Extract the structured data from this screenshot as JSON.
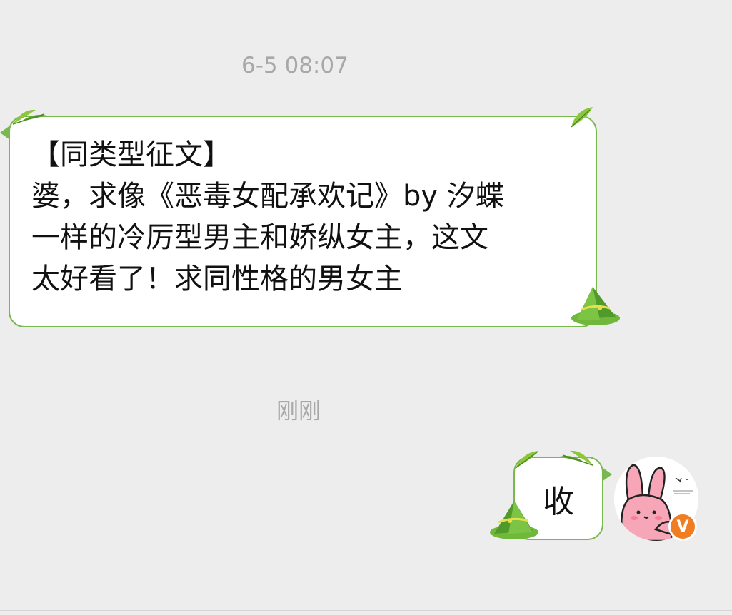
{
  "chat": {
    "messages": [
      {
        "timestamp": "6-5 08:07",
        "direction": "incoming",
        "lines": [
          "【同类型征文】",
          "婆，求像《恶毒女配承欢记》by 汐蝶",
          "一样的冷厉型男主和娇纵女主，这文",
          "太好看了！求同性格的男女主"
        ]
      },
      {
        "timestamp": "刚刚",
        "direction": "outgoing",
        "text": "收"
      }
    ]
  },
  "avatar": {
    "icon": "bunny-avatar-icon",
    "badge_text": "V"
  },
  "colors": {
    "background": "#ededed",
    "bubble_border": "#79b84f",
    "timestamp": "#a8a8a8",
    "badge": "#f07d22"
  }
}
